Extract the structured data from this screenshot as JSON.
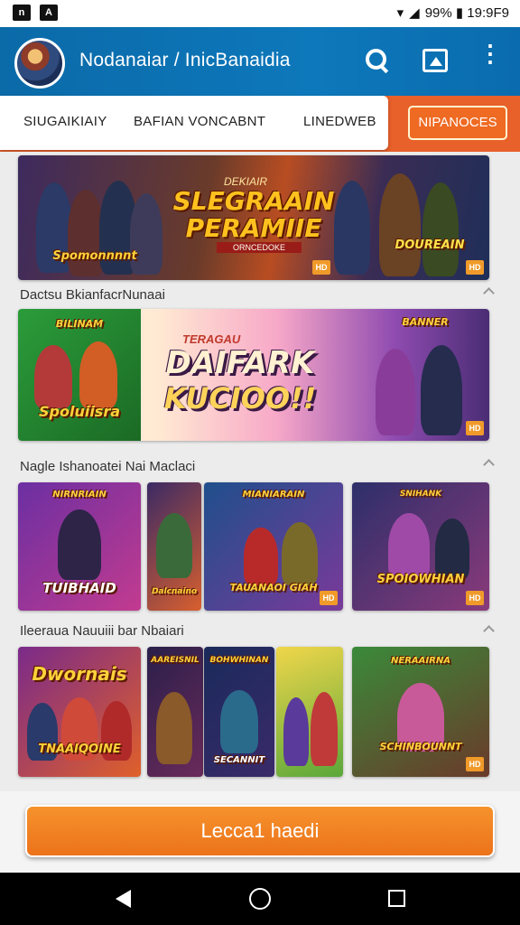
{
  "status_bar": {
    "left_icons": [
      "n",
      "A"
    ],
    "right_text": "99% ▮ 19:9F9"
  },
  "app_bar": {
    "title": "Nodanaiar / InicBanaidia",
    "icons": [
      "search-icon",
      "image-icon",
      "more-vert-icon"
    ]
  },
  "tabs": {
    "items": [
      "SIUGAIKIAIY",
      "BAFIAN VONCABNT",
      "LINEDWEB"
    ],
    "action_label": "NIPANOCES"
  },
  "featured": {
    "banner1": {
      "title_line1": "SLEGRAAIN",
      "title_line2": "PERAMIIE",
      "small_top": "DEKIAIR",
      "subtitle": "ORNCEDOKE",
      "left_logo": "Spomonnnnt",
      "right_logo": "DOUREAIN",
      "badge": "HD"
    },
    "section1_label": "Dactsu BkianfacrNunaai",
    "banner2": {
      "small_top": "TERAGAU",
      "title_line1": "DAIFARK",
      "title_line2": "KUCIOO!!",
      "left_logo_top": "BILINAM",
      "left_logo": "Spoluiisra",
      "right_logo": "BANNER",
      "badge": "HD"
    }
  },
  "section2": {
    "label": "Nagle Ishanoatei Nai Maclaci",
    "tiles": [
      {
        "logo": "NIRNRIAIN",
        "title": "TUIBHAID",
        "badge": ""
      },
      {
        "logo": "",
        "title": "Dalcnaino",
        "badge": ""
      },
      {
        "logo": "MIANIARAIN",
        "title": "TAUANAOI GIAH",
        "badge": "HD"
      },
      {
        "logo": "SNIHANK",
        "title": "SPOIOWHIAN",
        "badge": "HD"
      }
    ]
  },
  "section3": {
    "label": "Ileeraua Nauuiii bar Nbaiari",
    "tiles": [
      {
        "logo": "Dwornais",
        "title": "TNAAIQOINE",
        "badge": ""
      },
      {
        "logo": "AAREISNIL",
        "title": "",
        "badge": ""
      },
      {
        "logo": "BOHWHINAN",
        "title": "SECANNIT",
        "badge": ""
      },
      {
        "logo": "",
        "title": "",
        "badge": ""
      },
      {
        "logo": "NERAAIRNA",
        "title": "SCHINBOUNNT",
        "badge": "HD"
      }
    ]
  },
  "cta": {
    "label": "Lecca1 haedi"
  },
  "colors": {
    "app_bar": "#0d78bb",
    "accent_orange": "#ef6a22",
    "cta": "#f08826"
  }
}
